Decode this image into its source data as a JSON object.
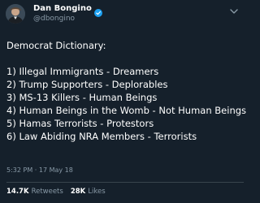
{
  "author": {
    "display_name": "Dan Bongino",
    "handle": "@dbongino",
    "verified": true
  },
  "tweet": {
    "headline": "Democrat Dictionary:",
    "items": [
      "1) Illegal Immigrants - Dreamers",
      "2) Trump Supporters - Deplorables",
      "3) MS-13 Killers - Human Beings",
      "4) Human Beings in the Womb - Not Human Beings",
      "5) Hamas Terrorists - Protestors",
      "6) Law Abiding NRA Members - Terrorists"
    ],
    "timestamp": "5:32 PM · 17 May 18"
  },
  "stats": {
    "retweets_count": "14.7K",
    "retweets_label": "Retweets",
    "likes_count": "28K",
    "likes_label": "Likes"
  },
  "icons": {
    "verified": "verified-badge-icon",
    "more": "chevron-down-icon"
  },
  "colors": {
    "background": "#15202b",
    "text": "#ffffff",
    "secondary_text": "#8899a6",
    "verified": "#1da1f2",
    "divider": "#38444d"
  }
}
